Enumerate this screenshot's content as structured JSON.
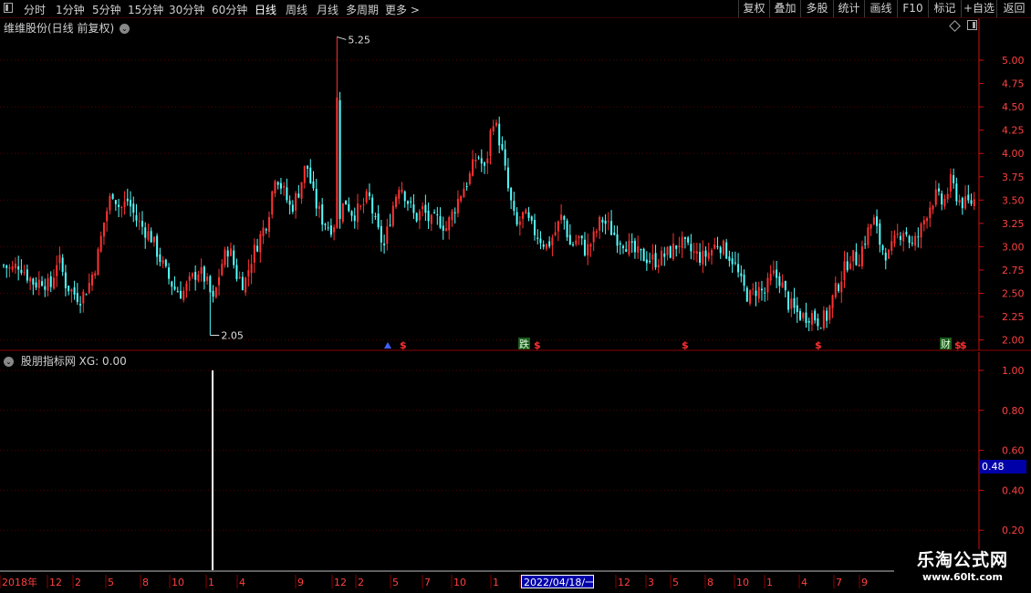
{
  "toolbar": {
    "periods": [
      "分时",
      "1分钟",
      "5分钟",
      "15分钟",
      "30分钟",
      "60分钟",
      "日线",
      "周线",
      "月线",
      "多周期",
      "更多 >"
    ],
    "active_period": "日线",
    "right_buttons": [
      "复权",
      "叠加",
      "多股",
      "统计",
      "画线",
      "F10",
      "标记",
      "+自选",
      "返回"
    ]
  },
  "main_panel": {
    "title": "维维股份(日线 前复权)",
    "y_ticks": [
      "5.00",
      "4.75",
      "4.50",
      "4.25",
      "4.00",
      "3.75",
      "3.50",
      "3.25",
      "3.00",
      "2.75",
      "2.50",
      "2.25",
      "2.00"
    ],
    "high_label": "5.25",
    "low_label": "2.05",
    "markers": [
      {
        "text": "$",
        "color": "#ff3030"
      },
      {
        "text": "$",
        "color": "#ff3030"
      },
      {
        "text": "$",
        "color": "#ff3030"
      },
      {
        "text": "$",
        "color": "#ff3030"
      },
      {
        "text": "$",
        "color": "#ff3030"
      },
      {
        "text": "$",
        "color": "#ff3030"
      },
      {
        "text": "跌",
        "color": "#00c000"
      },
      {
        "text": "财",
        "color": "#00c000"
      }
    ]
  },
  "sub_panel": {
    "title": "股朋指标网  XG: 0.00",
    "y_ticks": [
      "1.00",
      "0.80",
      "0.60",
      "0.40",
      "0.20"
    ],
    "current_value": "0.48"
  },
  "date_axis": {
    "labels": [
      "2018年",
      "12",
      "2",
      "5",
      "8",
      "10",
      "1",
      "4",
      "9",
      "12",
      "2",
      "5",
      "7",
      "10",
      "1",
      "4",
      "12",
      "3",
      "5",
      "8",
      "10",
      "1",
      "4",
      "7",
      "9"
    ],
    "selected_date": "2022/04/18/一"
  },
  "watermark": {
    "title": "乐淘公式网",
    "url": "www.60lt.com"
  },
  "colors": {
    "up": "#ff3232",
    "down": "#54ffff",
    "grid": "#5a0000",
    "axis": "#d01010",
    "axis_text": "#ff4040",
    "signal": "#ffffff"
  },
  "chart_data": {
    "type": "candlestick",
    "y_range": [
      2.0,
      5.0
    ],
    "high": 5.25,
    "low": 2.05,
    "close_path": [
      2.8,
      2.75,
      2.82,
      2.7,
      2.6,
      2.65,
      2.55,
      2.9,
      2.6,
      2.5,
      2.45,
      2.6,
      2.85,
      3.3,
      3.6,
      3.4,
      3.5,
      3.3,
      3.2,
      3.1,
      2.9,
      2.7,
      2.55,
      2.5,
      2.62,
      2.75,
      2.65,
      2.4,
      2.8,
      3.0,
      2.7,
      2.6,
      2.9,
      3.1,
      3.3,
      3.8,
      3.6,
      3.4,
      3.6,
      3.9,
      3.5,
      3.3,
      3.2,
      3.3,
      3.5,
      3.35,
      3.4,
      3.55,
      3.2,
      3.0,
      3.4,
      3.7,
      3.5,
      3.3,
      3.4,
      3.25,
      3.3,
      3.2,
      3.4,
      3.6,
      3.75,
      4.0,
      3.8,
      4.4,
      4.1,
      3.6,
      3.2,
      3.35,
      3.2,
      3.1,
      3.0,
      3.15,
      3.35,
      3.0,
      3.1,
      2.95,
      3.1,
      3.3,
      3.2,
      3.1,
      3.05,
      2.95,
      2.9,
      2.88,
      2.85,
      2.9,
      2.95,
      3.05,
      2.98,
      2.92,
      2.88,
      2.95,
      3.05,
      2.95,
      2.85,
      2.6,
      2.45,
      2.55,
      2.5,
      2.7,
      2.65,
      2.4,
      2.3,
      2.25,
      2.28,
      2.2,
      2.25,
      2.5,
      2.7,
      2.9,
      2.85,
      3.1,
      3.3,
      3.0,
      2.9,
      3.1,
      3.2,
      3.0,
      3.15,
      3.4,
      3.55,
      3.45,
      3.7,
      3.5,
      3.45,
      3.5
    ],
    "signal": {
      "value": 1.0,
      "position": "early 2019"
    }
  }
}
